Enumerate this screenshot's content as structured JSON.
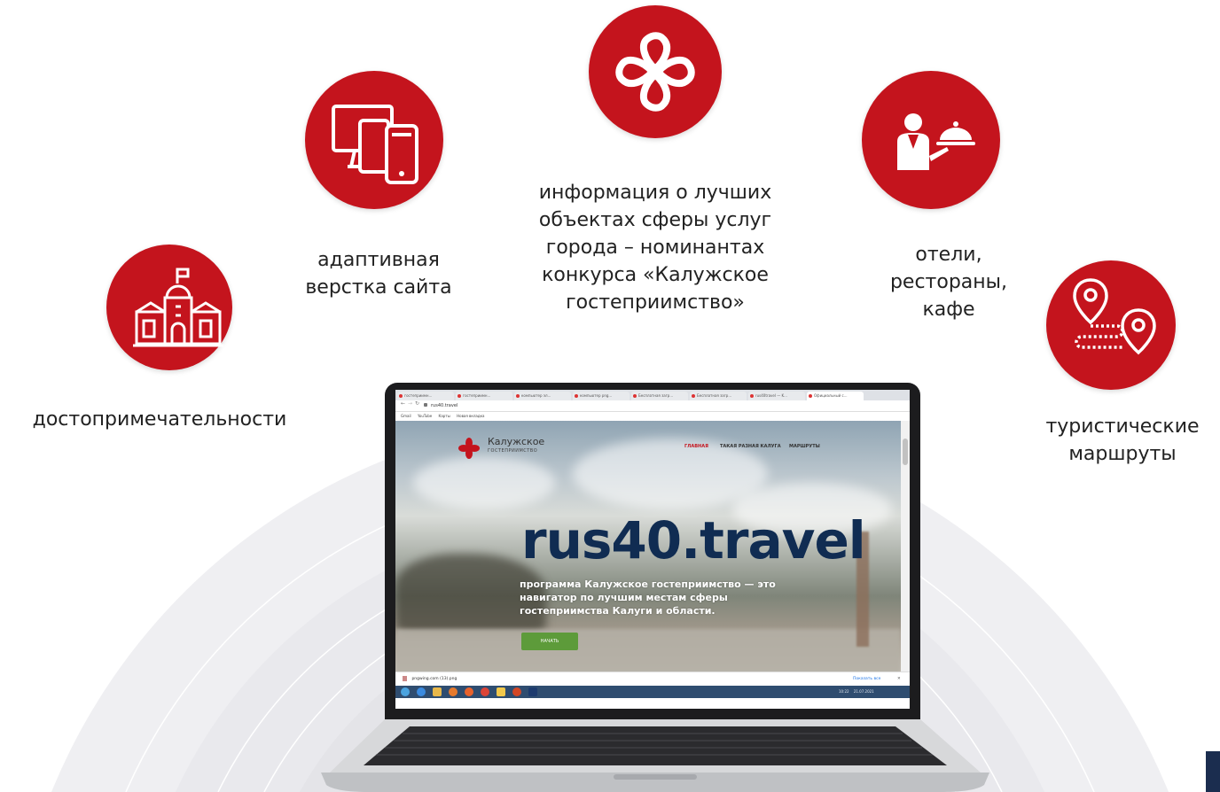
{
  "features": [
    {
      "label_lines": [
        "достопримечательности"
      ],
      "icon": "building-icon"
    },
    {
      "label_lines": [
        "адаптивная",
        "верстка сайта"
      ],
      "icon": "devices-icon"
    },
    {
      "label_lines": [
        "информация о лучших",
        "объектах сферы услуг",
        "города – номинантах",
        "конкурса «Калужское",
        "гостеприимство»"
      ],
      "icon": "flower-logo-icon"
    },
    {
      "label_lines": [
        "отели,",
        "рестораны,",
        "кафе"
      ],
      "icon": "waiter-cloche-icon"
    },
    {
      "label_lines": [
        "туристические",
        "маршруты"
      ],
      "icon": "route-pins-icon"
    }
  ],
  "laptop": {
    "domain": "rus40.travel",
    "browser": {
      "tabs": [
        "гостеприимн...",
        "гостеприимн...",
        "компьютер эл...",
        "компьютер png...",
        "Бесплатная загр...",
        "Бесплатная загр...",
        "rus40travel — K...",
        "Официальный с..."
      ],
      "url": "rus40.travel",
      "bookmarks": [
        "Gmail",
        "YouTube",
        "Карты",
        "Новая вкладка"
      ]
    },
    "site": {
      "logo_title": "Калужское",
      "logo_subtitle": "ГОСТЕПРИИМСТВО",
      "nav": [
        "ГЛАВНАЯ",
        "ТАКАЯ РАЗНАЯ КАЛУГА",
        "МАРШРУТЫ"
      ],
      "hero_lines": [
        "программа Калужское гостеприимство — это",
        "навигатор по лучшим местам сферы",
        "гостеприимства Калуги и области."
      ],
      "start_button": "НАЧАТЬ"
    },
    "download": {
      "file": "pngwing.com (13).png",
      "show_all": "Показать все"
    },
    "taskbar": {
      "time": "10:22",
      "date": "21.07.2021"
    }
  },
  "colors": {
    "accent": "#c4141d",
    "title": "#102c52",
    "arc": "#ececef"
  }
}
